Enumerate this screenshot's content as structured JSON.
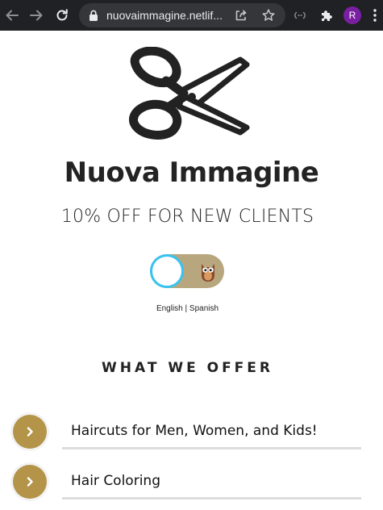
{
  "browser": {
    "url": "nuovaimmagine.netlif...",
    "avatar_letter": "R",
    "icons": [
      "back-arrow-icon",
      "forward-arrow-icon",
      "reload-icon",
      "lock-icon",
      "share-icon",
      "star-icon",
      "cast-icon",
      "puzzle-icon",
      "more-vert-icon"
    ]
  },
  "header": {
    "logo": "scissors-icon",
    "title": "Nuova Immagine",
    "subtitle": "10% OFF FOR NEW CLIENTS"
  },
  "toggle": {
    "state": "off",
    "thumb_icon": "owl-icon",
    "track_color": "#b8a67e",
    "knob_border_color": "#39c3f0"
  },
  "language": {
    "english": "English",
    "separator": "|",
    "spanish": "Spanish"
  },
  "offers": {
    "heading": "WHAT WE OFFER",
    "accent_color": "#b39448",
    "items": [
      {
        "label": "Haircuts for Men, Women, and Kids!"
      },
      {
        "label": "Hair Coloring"
      }
    ]
  }
}
